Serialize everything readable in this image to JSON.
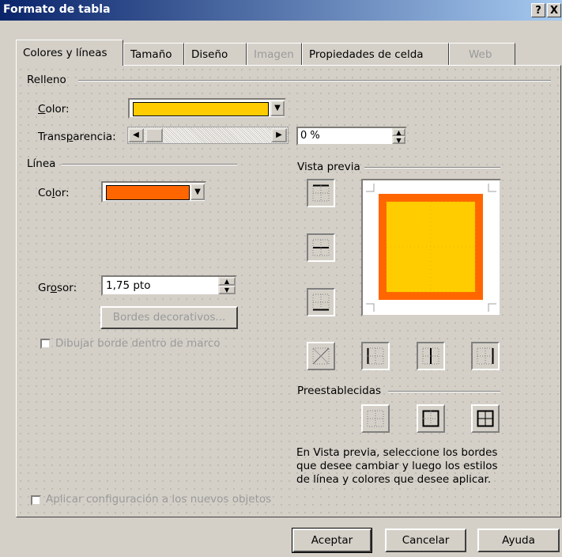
{
  "window": {
    "title": "Formato de tabla",
    "help_btn": "?",
    "close_btn": "X"
  },
  "tabs": [
    {
      "label": "Colores y líneas",
      "active": true
    },
    {
      "label": "Tamaño"
    },
    {
      "label": "Diseño"
    },
    {
      "label": "Imagen",
      "disabled": true
    },
    {
      "label": "Propiedades de celda"
    },
    {
      "label": "Web",
      "disabled": true
    }
  ],
  "fill": {
    "section_label": "Relleno",
    "color_label": "Color:",
    "color_value": "#ffcc00",
    "transparency_label": "Transparencia:",
    "transparency_percent": 0,
    "transparency_text": "0 %"
  },
  "line": {
    "section_label": "Línea",
    "color_label": "Color:",
    "color_value": "#ff6600",
    "weight_label": "Grosor:",
    "weight_value": "1,75 pto",
    "decorative_button": "Bordes decorativos...",
    "draw_inside_label": "Dibujar borde dentro de marco"
  },
  "preview": {
    "section_label": "Vista previa",
    "presets_label": "Preestablecidas",
    "instructions": "En Vista previa, seleccione los bordes que desee cambiar y luego los estilos de línea y colores que desee aplicar."
  },
  "apply_new_label": "Aplicar configuración a los nuevos objetos",
  "buttons": {
    "ok": "Aceptar",
    "cancel": "Cancelar",
    "help": "Ayuda"
  },
  "arrows": {
    "down": "▼",
    "left": "◀",
    "right": "▶",
    "up_small": "▲",
    "down_small": "▼"
  }
}
